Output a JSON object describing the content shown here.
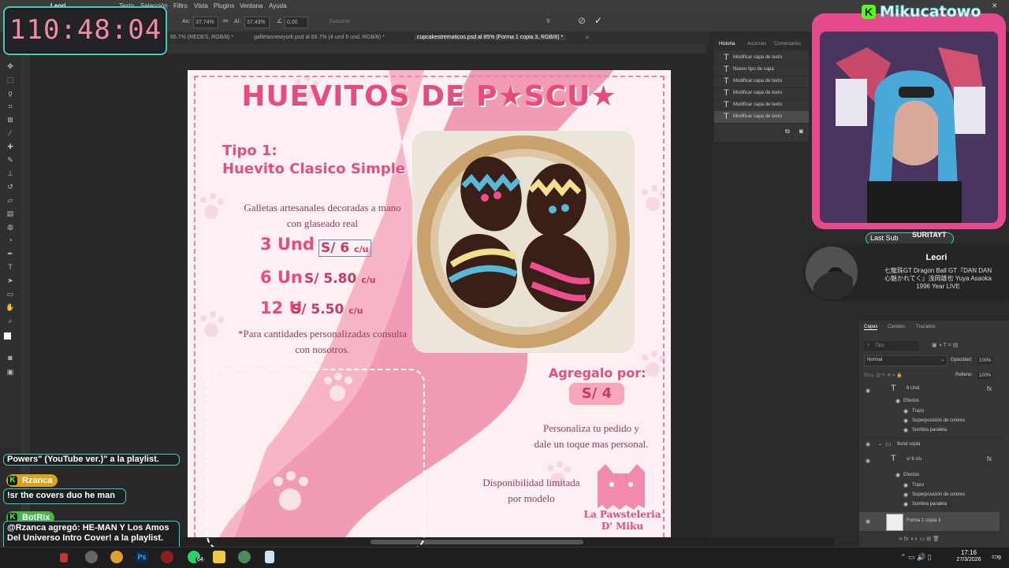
{
  "menu": {
    "items": [
      "Leori",
      "Texto",
      "Selección",
      "Filtro",
      "Vista",
      "Plugins",
      "Ventana",
      "Ayuda"
    ]
  },
  "options": {
    "width_label": "An:",
    "width_value": "37,74%",
    "height_label": "Al:",
    "height_value": "37,43%",
    "angle_value": "0,00",
    "smooth_label": "Suavizar"
  },
  "tabs": [
    {
      "label": "66.7% (REDES, RGB/8) *",
      "active": false
    },
    {
      "label": "galletasnewyork.psd al 66.7% (4 und  6 und, RGB/8) *",
      "active": false
    },
    {
      "label": "cupcakestrematicos.psd al 85% (Forma 1 copia 3, RGB/8) *",
      "active": true
    }
  ],
  "flyer": {
    "title": "HUEVITOS DE P★SCU★",
    "tipo_line1": "Tipo 1:",
    "tipo_line2": "Huevito Clasico Simple",
    "desc_line1": "Galletas artesanales decoradas a mano",
    "desc_line2": "con glaseado real",
    "prices": [
      {
        "qty": "3 Und",
        "price": "S/ 6",
        "unit": "c/u"
      },
      {
        "qty": "6 Un",
        "price": "S/ 5.80",
        "unit": "c/u"
      },
      {
        "qty": "12 U",
        "price": "S/ 5.50",
        "unit": "c/u"
      }
    ],
    "custom_line1": "*Para cantidades personalizadas consulta",
    "custom_line2": "con nosotros.",
    "addon_label": "Agregalo por:",
    "addon_price": "S/ 4",
    "personal_line1": "Personaliza tu pedido y",
    "personal_line2": "dale un toque mas personal.",
    "avail_line1": "Disponibilidad limitada",
    "avail_line2": "por modelo",
    "brand_line1": "La Pawsteleria",
    "brand_line2": "D' Miku"
  },
  "history": {
    "tabs": [
      "Historia",
      "Acciones",
      "Comentarios"
    ],
    "items": [
      "Modificar capa de texto",
      "Nuevo tipo de capa",
      "Modificar capa de texto",
      "Modificar capa de texto",
      "Modificar capa de texto",
      "Modificar capa de texto"
    ]
  },
  "layers": {
    "tabs": [
      "Capas",
      "Canales",
      "Trazados"
    ],
    "search_placeholder": "Tipo",
    "blend_mode": "Normal",
    "opacity_label": "Opacidad:",
    "opacity_value": "100%",
    "fill_label": "Relleno:",
    "fill_value": "100%",
    "rows": [
      {
        "name": "6 Und.",
        "kind": "text"
      },
      {
        "name": "Efectos",
        "kind": "effects"
      },
      {
        "name": "Trazo",
        "kind": "effect"
      },
      {
        "name": "Superposición de colores",
        "kind": "effect"
      },
      {
        "name": "Sombra paralela",
        "kind": "effect"
      },
      {
        "name": "9und copia",
        "kind": "group"
      },
      {
        "name": "s/ 6 c/u",
        "kind": "text"
      },
      {
        "name": "Efectos",
        "kind": "effects"
      },
      {
        "name": "Trazo",
        "kind": "effect"
      },
      {
        "name": "Superposición de colores",
        "kind": "effect"
      },
      {
        "name": "Sombra paralela",
        "kind": "effect"
      },
      {
        "name": "Forma 1 copia 3",
        "kind": "shape"
      }
    ]
  },
  "stream": {
    "timer": "110:48:04",
    "channel_name": "Mikucatowo",
    "last_sub_label": "Last Sub",
    "last_sub_name": "SURITAYT",
    "song_title": "Leori",
    "song_line1": "七龍珠GT Dragon Ball GT『DAN DAN",
    "song_line2": "心魅かれてく』浅岡雄也 Yuya Asaoka",
    "song_line3": "1996 Year LIVE",
    "chat": [
      {
        "user": "",
        "text": "Powers\" (YouTube ver.)\" a la playlist."
      },
      {
        "user": "Rzanca",
        "text": "!sr the covers duo he man"
      },
      {
        "user": "BotRix",
        "text": "@Rzanca agregó: HE-MAN Y Los Amos Del Universo Intro Cover! a la playlist."
      }
    ]
  },
  "taskbar": {
    "badge": "64",
    "time": "17:16",
    "date": "27/3/2026",
    "notif": "9"
  },
  "colors": {
    "accent_pink": "#e84c7c",
    "overlay_teal": "#49c7c6",
    "timer_pink": "#ef8ca1"
  }
}
